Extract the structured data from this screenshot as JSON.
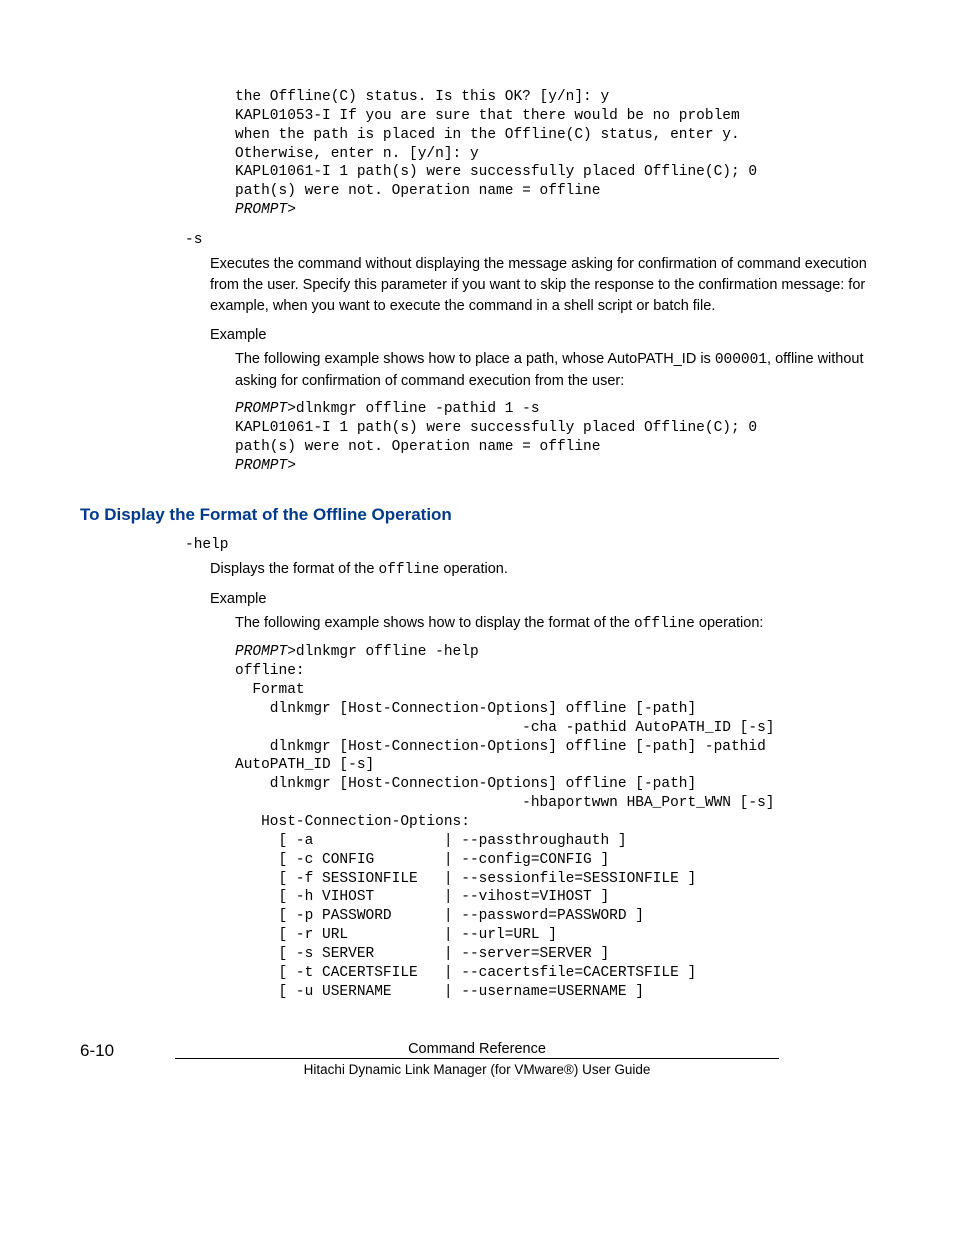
{
  "block1": {
    "l1": "the Offline(C) status. Is this OK? [y/n]: y",
    "l2": "KAPL01053-I If you are sure that there would be no problem",
    "l3": "when the path is placed in the Offline(C) status, enter y.",
    "l4": "Otherwise, enter n. [y/n]: y",
    "l5": "KAPL01061-I 1 path(s) were successfully placed Offline(C); 0",
    "l6": "path(s) were not. Operation name = offline",
    "l7": "PROMPT",
    "l8": ">"
  },
  "s_flag": "-s",
  "s_body": "Executes the command without displaying the message asking for confirmation of command execution from the user. Specify this parameter if you want to skip the response to the confirmation message: for example, when you want to execute the command in a shell script or batch file.",
  "example_label": "Example",
  "s_example": {
    "pre": "The following example shows how to place a path, whose AutoPATH_ID is ",
    "code": "000001",
    "post": ", offline without asking for confirmation of command execution from the user:"
  },
  "block2": {
    "p": "PROMPT",
    "gt": ">",
    "l1b": "dlnkmgr offline -pathid 1 -s",
    "l2": "KAPL01061-I 1 path(s) were successfully placed Offline(C); 0",
    "l3": "path(s) were not. Operation name = offline"
  },
  "heading": "To Display the Format of the Offline Operation",
  "help_flag": "-help",
  "help_body": {
    "pre": "Displays the format of the ",
    "code": "offline",
    "post": " operation."
  },
  "help_example": {
    "pre": "The following example shows how to display the format of the ",
    "code": "offline",
    "post": " operation:"
  },
  "block3": {
    "p": "PROMPT",
    "gt": ">",
    "l1b": "dlnkmgr offline -help",
    "l2": "offline:",
    "l3": "  Format",
    "l4": "    dlnkmgr [Host-Connection-Options] offline [-path]",
    "l5": "                                 -cha -pathid AutoPATH_ID [-s]",
    "l6": "    dlnkmgr [Host-Connection-Options] offline [-path] -pathid",
    "l7": "AutoPATH_ID [-s]",
    "l8": "    dlnkmgr [Host-Connection-Options] offline [-path]",
    "l9": "                                 -hbaportwwn HBA_Port_WWN [-s]",
    "l10": "   Host-Connection-Options:",
    "l11": "     [ -a               | --passthroughauth ]",
    "l12": "     [ -c CONFIG        | --config=CONFIG ]",
    "l13": "     [ -f SESSIONFILE   | --sessionfile=SESSIONFILE ]",
    "l14": "     [ -h VIHOST        | --vihost=VIHOST ]",
    "l15": "     [ -p PASSWORD      | --password=PASSWORD ]",
    "l16": "     [ -r URL           | --url=URL ]",
    "l17": "     [ -s SERVER        | --server=SERVER ]",
    "l18": "     [ -t CACERTSFILE   | --cacertsfile=CACERTSFILE ]",
    "l19": "     [ -u USERNAME      | --username=USERNAME ]"
  },
  "footer": {
    "page_num": "6-10",
    "title": "Command Reference",
    "sub": "Hitachi Dynamic Link Manager (for VMware®) User Guide"
  }
}
